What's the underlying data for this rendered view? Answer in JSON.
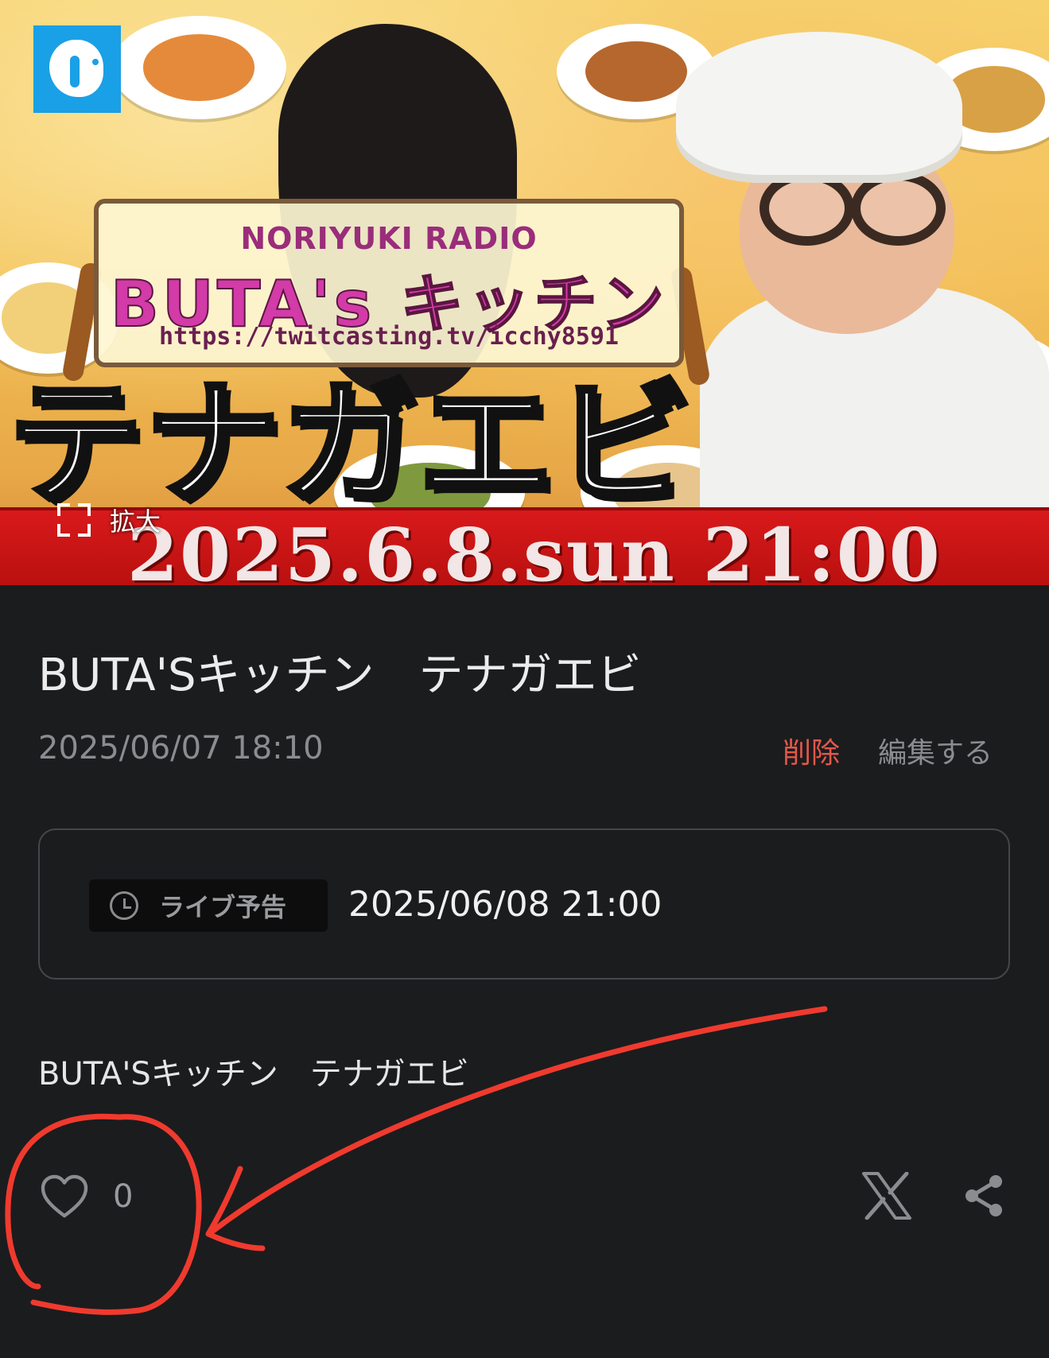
{
  "banner": {
    "sign_line1": "NORIYUKI RADIO",
    "sign_line2": "BUTA's キッチン",
    "sign_url": "https://twitcasting.tv/icchy8591",
    "big_title": "テナガエビ",
    "date_strip": "2025.6.8.sun  21:00",
    "zoom_label": "拡大",
    "app_logo_icon": "twitcasting-logo-icon",
    "zoom_icon": "expand-icon"
  },
  "post": {
    "title": "BUTA'Sキッチン　テナガエビ",
    "timestamp": "2025/06/07 18:10",
    "delete_label": "削除",
    "edit_label": "編集する"
  },
  "live_notice": {
    "badge_icon": "clock-icon",
    "badge_label": "ライブ予告",
    "datetime": "2025/06/08 21:00"
  },
  "description": "BUTA'Sキッチン　テナガエビ",
  "actions": {
    "like_icon": "heart-icon",
    "like_count": "0",
    "x_icon": "x-logo-icon",
    "share_icon": "share-icon"
  },
  "colors": {
    "background": "#1b1c1e",
    "delete": "#e3574a",
    "muted": "#8b8c8f",
    "annotation": "#f03a2e",
    "date_strip": "#d9191b"
  }
}
